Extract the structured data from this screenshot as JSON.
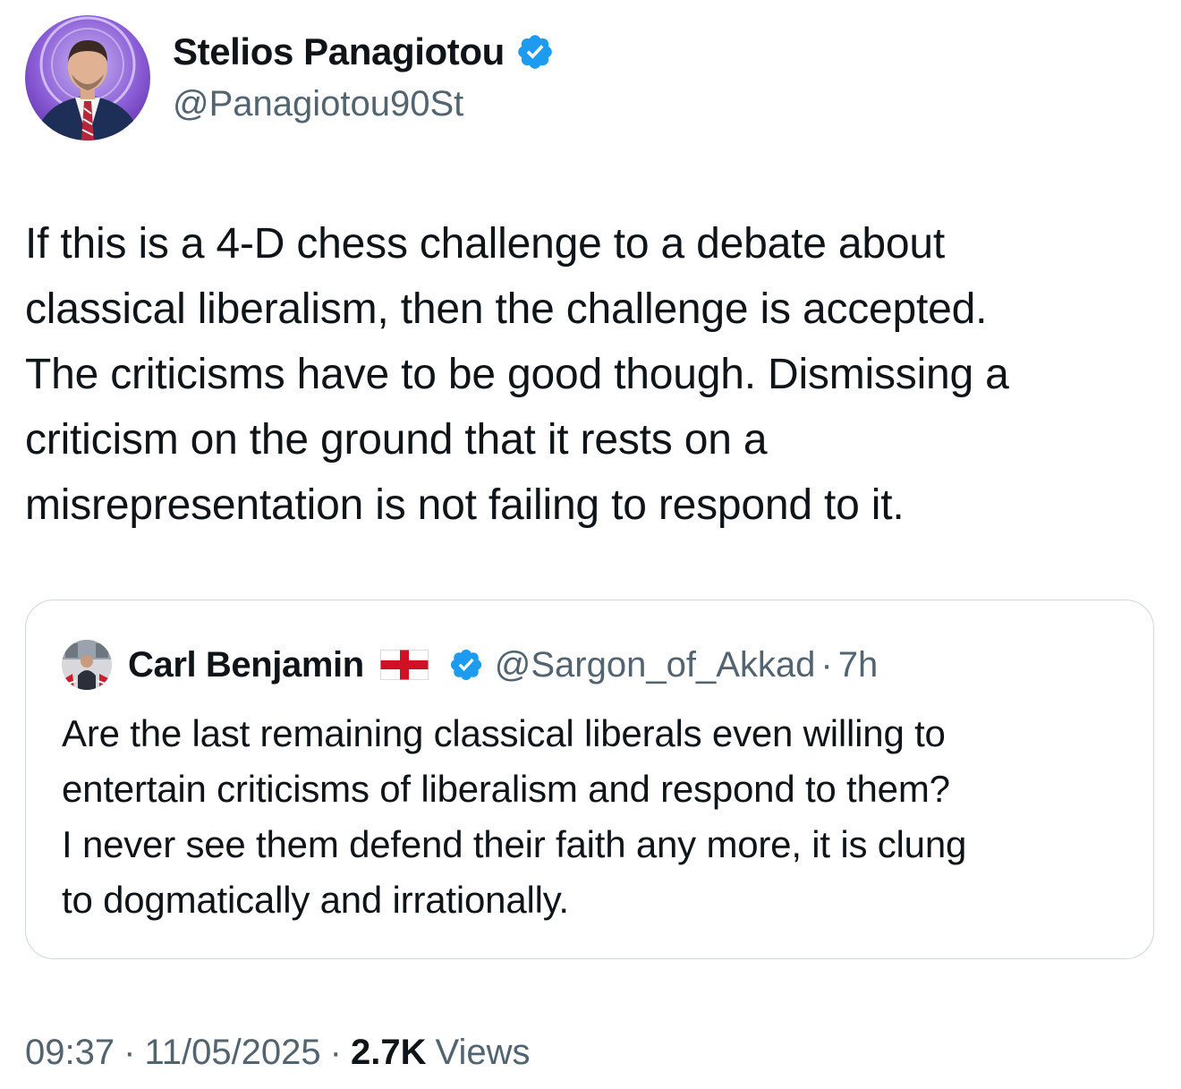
{
  "author": {
    "name": "Stelios Panagiotou",
    "handle": "@Panagiotou90St",
    "verified": true,
    "avatar_icon": "profile-photo"
  },
  "tweet": {
    "lines": [
      "If this is a 4-D chess challenge to a debate about",
      "classical liberalism, then the challenge is accepted.",
      "The criticisms have to be good though. Dismissing a",
      "criticism on the ground that it rests on a",
      "misrepresentation is not failing to respond to it."
    ]
  },
  "quote": {
    "name": "Carl Benjamin",
    "flag_icon": "england-flag",
    "verified": true,
    "handle": "@Sargon_of_Akkad",
    "separator": "·",
    "time": "7h",
    "lines": [
      "Are the last remaining classical liberals even willing to",
      "entertain criticisms of liberalism and respond to them?",
      "I never see them defend their faith any more, it is clung",
      "to dogmatically and irrationally."
    ]
  },
  "meta": {
    "time": "09:37",
    "separator": "·",
    "date": "11/05/2025",
    "views_count": "2.7K",
    "views_label": "Views"
  },
  "colors": {
    "text_primary": "#0f1419",
    "text_secondary": "#536471",
    "verified_blue": "#1d9bf0",
    "border": "#cfd9de"
  }
}
